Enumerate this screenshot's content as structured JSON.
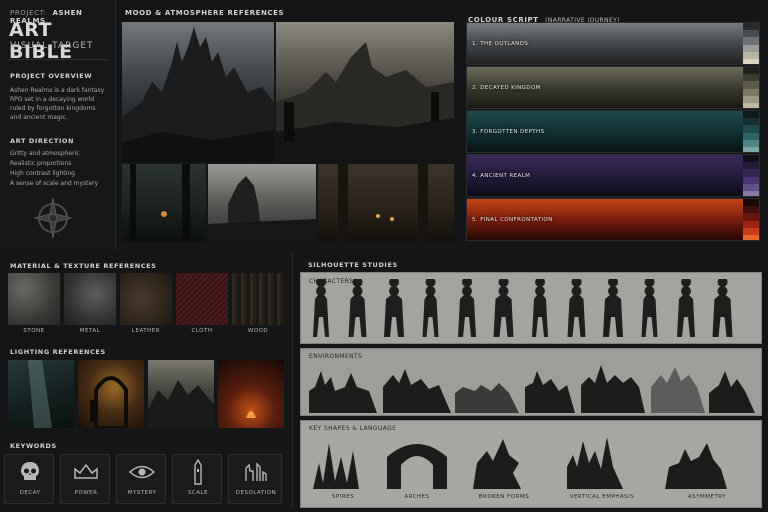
{
  "project": {
    "label": "PROJECT:",
    "name": "ASHEN REALMS"
  },
  "title": "ART BIBLE",
  "subtitle": "VISUAL TARGET",
  "overview": {
    "heading": "PROJECT OVERVIEW",
    "lines": [
      "Ashen Realms is a dark fantasy",
      "RPG set in a decaying world",
      "ruled by forgotten kingdoms",
      "and ancient magic."
    ]
  },
  "direction": {
    "heading": "ART DIRECTION",
    "lines": [
      "Gritty and atmospheric",
      "Realistic proportions",
      "High contrast lighting",
      "A sense of scale and mystery"
    ]
  },
  "mood": {
    "heading": "MOOD & ATMOSPHERE REFERENCES"
  },
  "colour_script": {
    "heading": "COLOUR SCRIPT",
    "subheading": "(NARRATIVE JOURNEY)",
    "rows": [
      {
        "label": "1. THE OUTLANDS",
        "colors": [
          "#2a2c2e",
          "#4a4d50",
          "#6f7275",
          "#9a9b99",
          "#b8b4a4",
          "#d9d4c2"
        ]
      },
      {
        "label": "2. DECAYED KINGDOM",
        "colors": [
          "#1f211d",
          "#3b3d33",
          "#5c5a48",
          "#7b7a63",
          "#9c9a82",
          "#c0bb9f"
        ]
      },
      {
        "label": "3. FORGOTTEN DEPTHS",
        "colors": [
          "#0d1a1c",
          "#143033",
          "#1f4a4c",
          "#2d6566",
          "#4f8584",
          "#7aa8a4"
        ]
      },
      {
        "label": "4. ANCIENT REALM",
        "colors": [
          "#120f1d",
          "#221a36",
          "#332652",
          "#4a3670",
          "#62508a",
          "#8a7aa8"
        ]
      },
      {
        "label": "5. FINAL CONFRONTATION",
        "colors": [
          "#1a0806",
          "#3d0f09",
          "#6b160c",
          "#9c2410",
          "#c73d18",
          "#e8682a"
        ]
      }
    ]
  },
  "materials": {
    "heading": "MATERIAL & TEXTURE REFERENCES",
    "items": [
      "STONE",
      "METAL",
      "LEATHER",
      "CLOTH",
      "WOOD"
    ]
  },
  "lighting": {
    "heading": "LIGHTING REFERENCES"
  },
  "keywords": {
    "heading": "KEYWORDS",
    "items": [
      {
        "label": "DECAY",
        "icon": "skull-icon"
      },
      {
        "label": "POWER",
        "icon": "crown-icon"
      },
      {
        "label": "MYSTERY",
        "icon": "eye-icon"
      },
      {
        "label": "SCALE",
        "icon": "tower-icon"
      },
      {
        "label": "DESOLATION",
        "icon": "ruins-icon"
      }
    ]
  },
  "silhouettes": {
    "heading": "SILHOUETTE STUDIES",
    "characters": "CHARACTERS",
    "environments": "ENVIRONMENTS",
    "shapes": {
      "heading": "KEY SHAPES & LANGUAGE",
      "items": [
        "SPIRES",
        "ARCHES",
        "BROKEN FORMS",
        "VERTICAL EMPHASIS",
        "ASYMMETRY"
      ]
    }
  }
}
